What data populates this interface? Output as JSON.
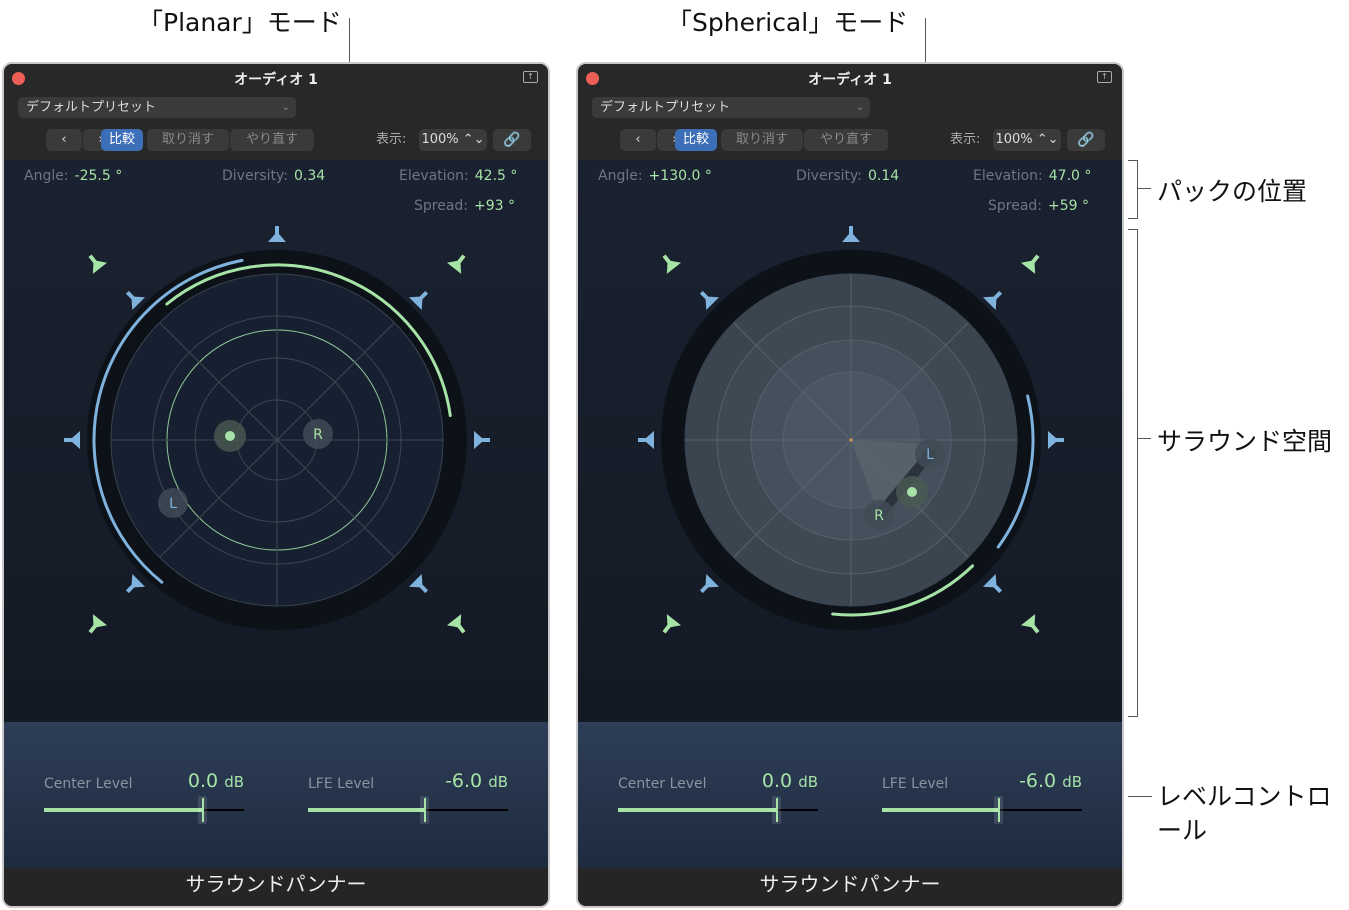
{
  "callouts": {
    "planar_mode": "「Planar」モード",
    "spherical_mode": "「Spherical」モード",
    "puck_position": "パックの位置",
    "surround_space": "サラウンド空間",
    "level_control_1": "レベルコントロ",
    "level_control_2": "ール"
  },
  "panels": [
    {
      "mode": "planar",
      "window_title": "オーディオ 1",
      "preset": "デフォルトプリセット",
      "nav_prev": "‹",
      "nav_next": "›",
      "compare": "比較",
      "undo": "取り消す",
      "redo": "やり直す",
      "view_label": "表示:",
      "zoom": "100% ⌃⌄",
      "link_icon": "link-icon",
      "angle_label": "Angle:",
      "angle": "-25.5 °",
      "diversity_label": "Diversity:",
      "diversity": "0.34",
      "elevation_label": "Elevation:",
      "elevation": "42.5 °",
      "spread_label": "Spread:",
      "spread": "+93 °",
      "puck_L": "L",
      "puck_R": "R",
      "mode_planar": "Planar",
      "mode_spherical": "Spherical",
      "center_label": "Center Level",
      "center_value": "0.0",
      "center_unit": "dB",
      "center_fraction": 0.79,
      "lfe_label": "LFE Level",
      "lfe_value": "-6.0",
      "lfe_unit": "dB",
      "lfe_fraction": 0.58,
      "footer": "サラウンドパンナー"
    },
    {
      "mode": "spherical",
      "window_title": "オーディオ 1",
      "preset": "デフォルトプリセット",
      "nav_prev": "‹",
      "nav_next": "›",
      "compare": "比較",
      "undo": "取り消す",
      "redo": "やり直す",
      "view_label": "表示:",
      "zoom": "100% ⌃⌄",
      "link_icon": "link-icon",
      "angle_label": "Angle:",
      "angle": "+130.0 °",
      "diversity_label": "Diversity:",
      "diversity": "0.14",
      "elevation_label": "Elevation:",
      "elevation": "47.0 °",
      "spread_label": "Spread:",
      "spread": "+59 °",
      "puck_L": "L",
      "puck_R": "R",
      "mode_planar": "Planar",
      "mode_spherical": "Spherical",
      "center_label": "Center Level",
      "center_value": "0.0",
      "center_unit": "dB",
      "center_fraction": 0.79,
      "lfe_label": "LFE Level",
      "lfe_value": "-6.0",
      "lfe_unit": "dB",
      "lfe_fraction": 0.58,
      "footer": "サラウンドパンナー"
    }
  ],
  "colors": {
    "green": "#a6e3a6",
    "blue": "#7fb2dd",
    "accent": "#3d6fb8"
  }
}
